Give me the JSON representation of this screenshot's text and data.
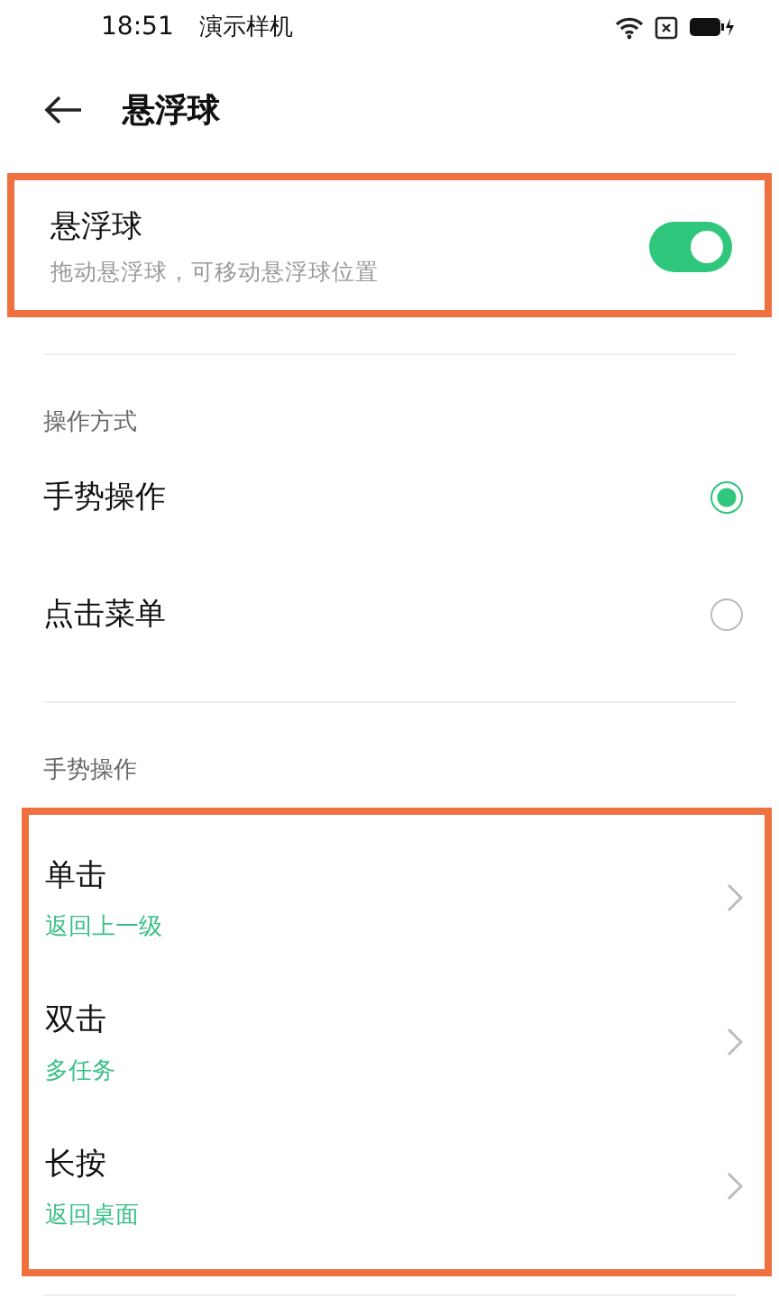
{
  "status_bar": {
    "time": "18:51",
    "carrier": "演示样机"
  },
  "header": {
    "title": "悬浮球"
  },
  "toggle_row": {
    "title": "悬浮球",
    "subtitle": "拖动悬浮球，可移动悬浮球位置",
    "on": true,
    "highlighted": true
  },
  "mode_section": {
    "label": "操作方式",
    "options": [
      {
        "label": "手势操作",
        "selected": true
      },
      {
        "label": "点击菜单",
        "selected": false
      }
    ]
  },
  "gesture_section": {
    "label": "手势操作",
    "highlighted": true,
    "items": [
      {
        "title": "单击",
        "value": "返回上一级"
      },
      {
        "title": "双击",
        "value": "多任务"
      },
      {
        "title": "长按",
        "value": "返回桌面"
      }
    ]
  }
}
